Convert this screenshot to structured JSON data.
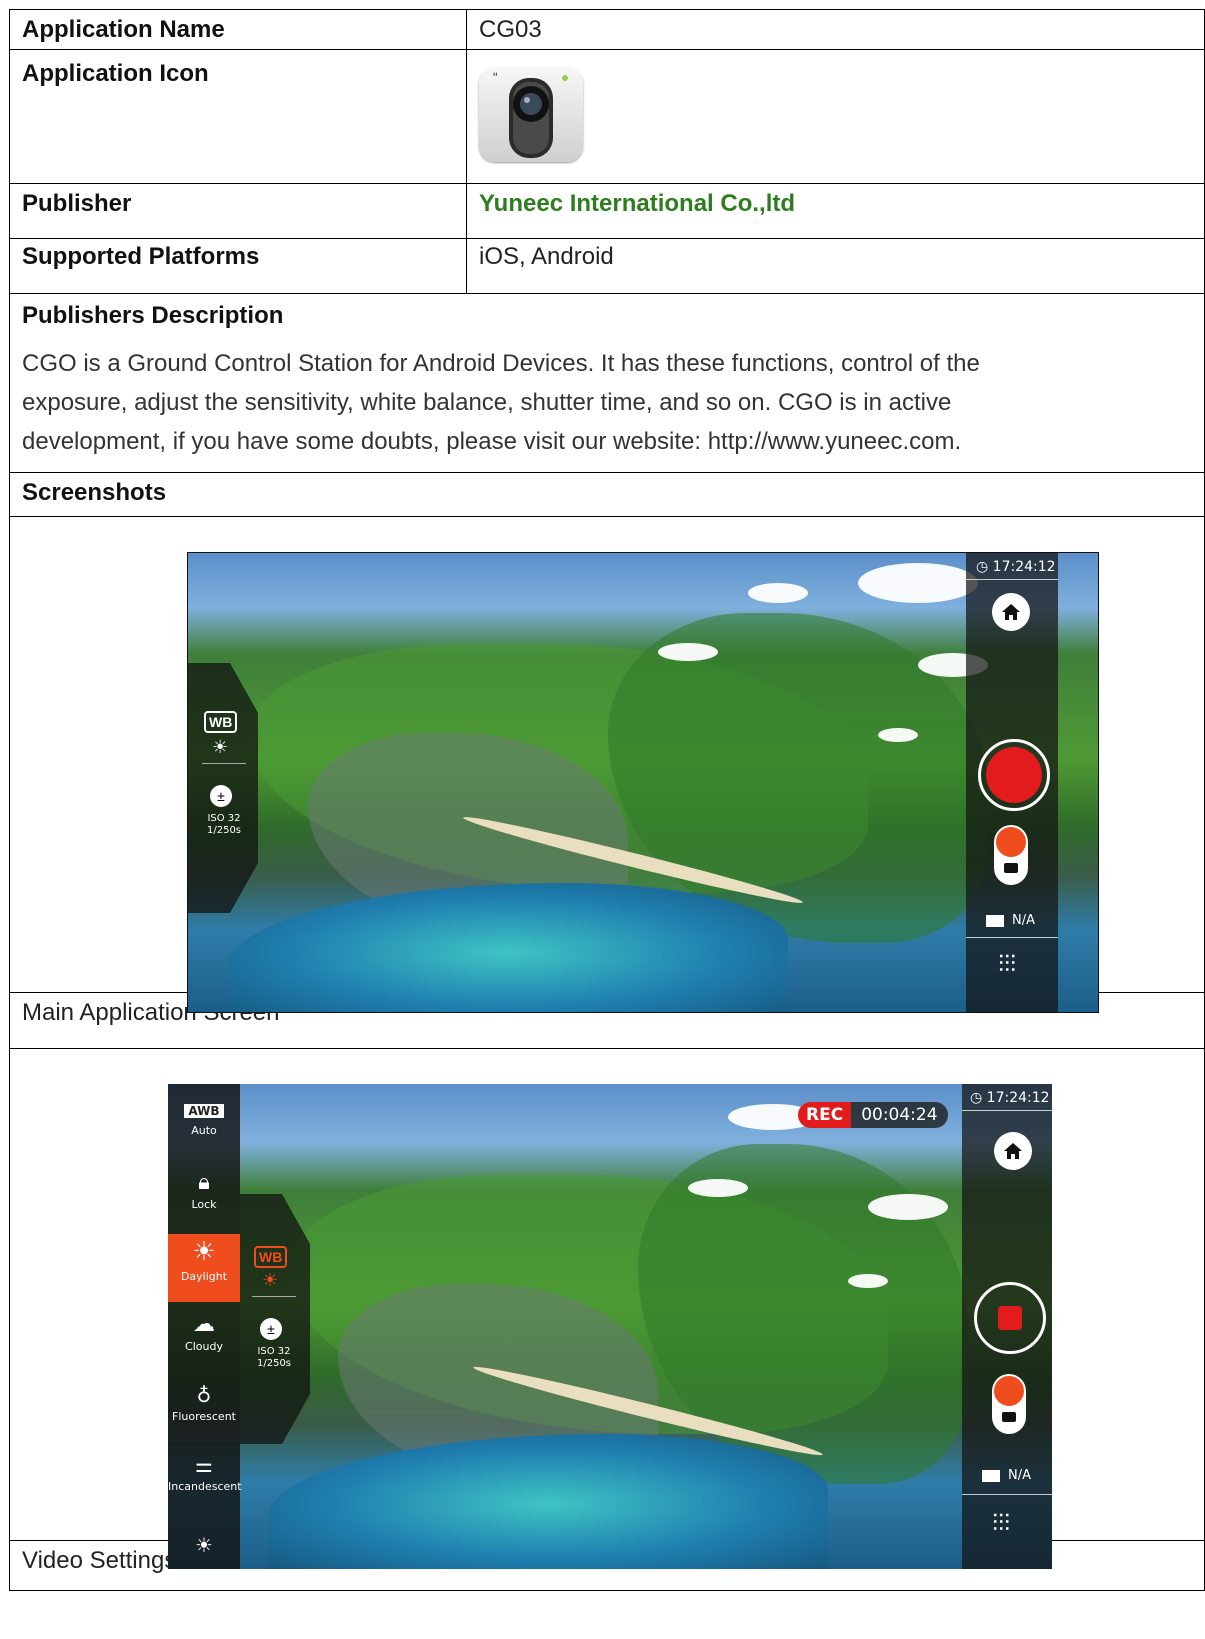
{
  "rows": {
    "app_name": {
      "label": "Application Name",
      "value": "CG03"
    },
    "app_icon": {
      "label": "Application Icon",
      "icon": "camera-app-icon"
    },
    "publisher": {
      "label": "Publisher",
      "value": "Yuneec International Co.,ltd"
    },
    "platforms": {
      "label": "Supported Platforms",
      "value": "iOS, Android"
    }
  },
  "description": {
    "heading": "Publishers Description",
    "line1": "CGO is a Ground Control Station for Android Devices. It has these functions, control of the",
    "line2": "exposure, adjust the sensitivity, white balance, shutter time, and so on. CGO is in active",
    "line3": "development, if you have some doubts, please visit our website: http://www.yuneec.com."
  },
  "screenshots": {
    "heading": "Screenshots",
    "main": {
      "caption": "Main Application Screen",
      "clock": "◷ 17:24:12",
      "wb_label": "WB",
      "iso": "ISO 32",
      "shutter": "1/250s",
      "sd_status": "N/A"
    },
    "video": {
      "caption": "Video Settings Screen",
      "clock": "◷ 17:24:12",
      "rec_label": "REC",
      "rec_time": "00:04:24",
      "wb_label": "WB",
      "iso": "ISO 32",
      "shutter": "1/250s",
      "sd_status": "N/A",
      "wb_options": [
        {
          "label": "Auto",
          "badge": "AWB"
        },
        {
          "label": "Lock"
        },
        {
          "label": "Daylight"
        },
        {
          "label": "Cloudy"
        },
        {
          "label": "Fluorescent"
        },
        {
          "label": "Incandescent"
        }
      ]
    }
  },
  "colors": {
    "publisher_link": "#2e7d1f",
    "record": "#e21c1c",
    "accent": "#f04d1e"
  }
}
